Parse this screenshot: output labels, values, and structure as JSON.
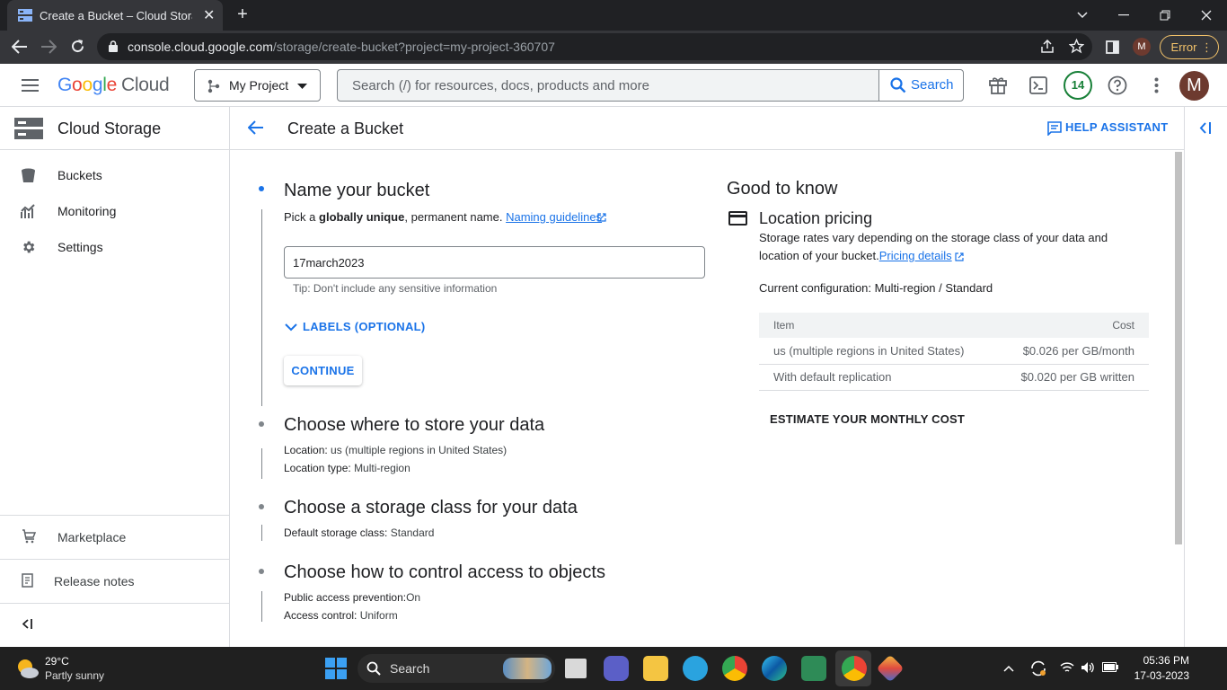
{
  "browser": {
    "tab_title": "Create a Bucket – Cloud Storage",
    "url_host": "console.cloud.google.com",
    "url_path": "/storage/create-bucket?project=my-project-360707",
    "profile_initial": "M",
    "error_label": "Error"
  },
  "header": {
    "logo_letters": [
      "G",
      "o",
      "o",
      "g",
      "l",
      "e"
    ],
    "logo_suffix": "Cloud",
    "project_name": "My Project",
    "search_placeholder": "Search (/) for resources, docs, products and more",
    "search_button": "Search",
    "notifications_count": "14",
    "avatar_initial": "M"
  },
  "sidebar": {
    "product_title": "Cloud Storage",
    "items": [
      {
        "label": "Buckets",
        "icon": "bucket-icon"
      },
      {
        "label": "Monitoring",
        "icon": "monitoring-icon"
      },
      {
        "label": "Settings",
        "icon": "gear-icon"
      }
    ],
    "bottom_items": [
      {
        "label": "Marketplace",
        "icon": "cart-icon"
      },
      {
        "label": "Release notes",
        "icon": "notes-icon"
      }
    ]
  },
  "page": {
    "title": "Create a Bucket",
    "help_assistant": "HELP ASSISTANT"
  },
  "step1": {
    "heading": "Name your bucket",
    "desc_pre": "Pick a ",
    "desc_bold": "globally unique",
    "desc_post": ", permanent name. ",
    "desc_link": "Naming guidelines",
    "input_value": "17march2023",
    "tip": "Tip: Don't include any sensitive information",
    "labels_button": "LABELS (OPTIONAL)",
    "continue_button": "CONTINUE"
  },
  "step2": {
    "heading": "Choose where to store your data",
    "location_label": "Location: ",
    "location_value": "us (multiple regions in United States)",
    "type_label": "Location type: ",
    "type_value": "Multi-region"
  },
  "step3": {
    "heading": "Choose a storage class for your data",
    "class_label": "Default storage class: ",
    "class_value": "Standard"
  },
  "step4": {
    "heading": "Choose how to control access to objects",
    "prevention_label": "Public access prevention:",
    "prevention_value": "On",
    "control_label": "Access control: ",
    "control_value": "Uniform"
  },
  "good_to_know": {
    "title": "Good to know",
    "subtitle": "Location pricing",
    "desc": "Storage rates vary depending on the storage class of your data and location of your bucket.",
    "desc_link": "Pricing details",
    "current_label": "Current configuration: ",
    "current_value": "Multi-region / Standard",
    "table_headers": [
      "Item",
      "Cost"
    ],
    "table_rows": [
      [
        "us (multiple regions in United States)",
        "$0.026 per GB/month"
      ],
      [
        "With default replication",
        "$0.020 per GB written"
      ]
    ],
    "estimate": "ESTIMATE YOUR MONTHLY COST"
  },
  "taskbar": {
    "temperature": "29°C",
    "weather": "Partly sunny",
    "search_label": "Search",
    "time": "05:36 PM",
    "date": "17-03-2023"
  }
}
